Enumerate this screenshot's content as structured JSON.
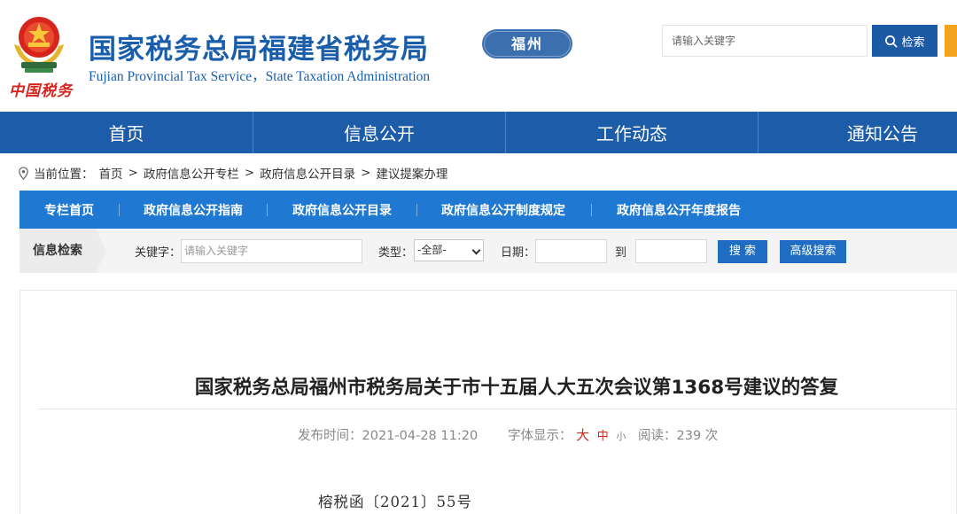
{
  "header": {
    "title": "国家税务总局福建省税务局",
    "subtitle": "Fujian Provincial Tax Service，State Taxation Administration",
    "calligraphy": "中国税务",
    "region": "福州",
    "search_placeholder": "请输入关键字",
    "search_button": "检索",
    "emblem_icon": "national-tax-emblem-icon"
  },
  "main_nav": [
    "首页",
    "信息公开",
    "工作动态",
    "通知公告"
  ],
  "breadcrumb": {
    "prefix": "当前位置：",
    "items": [
      "首页",
      ">",
      "政府信息公开专栏",
      ">",
      "政府信息公开目录",
      ">",
      "建议提案办理"
    ]
  },
  "column_nav": [
    "专栏首页",
    "政府信息公开指南",
    "政府信息公开目录",
    "政府信息公开制度规定",
    "政府信息公开年度报告"
  ],
  "filter": {
    "label": "信息检索",
    "keyword_label": "关键字：",
    "keyword_placeholder": "请输入关键字",
    "type_label": "类型：",
    "type_value": "-全部-",
    "date_label": "日期：",
    "to_label": "到",
    "search_button": "搜 索",
    "advanced_button": "高级搜索"
  },
  "article": {
    "title": "国家税务总局福州市税务局关于市十五届人大五次会议第1368号建议的答复",
    "publish_label": "发布时间：",
    "publish_time": "2021-04-28 11:20",
    "font_label": "字体显示：",
    "font_large": "大",
    "font_medium": "中",
    "font_small": "小",
    "read_label": "阅读：",
    "read_count": "239 次",
    "doc_number": "榕税函〔2021〕55号"
  },
  "colors": {
    "brand_blue": "#1c5ca9",
    "column_blue": "#1f78d1",
    "accent_orange": "#f4a31c",
    "highlight_red": "#d4261c"
  }
}
